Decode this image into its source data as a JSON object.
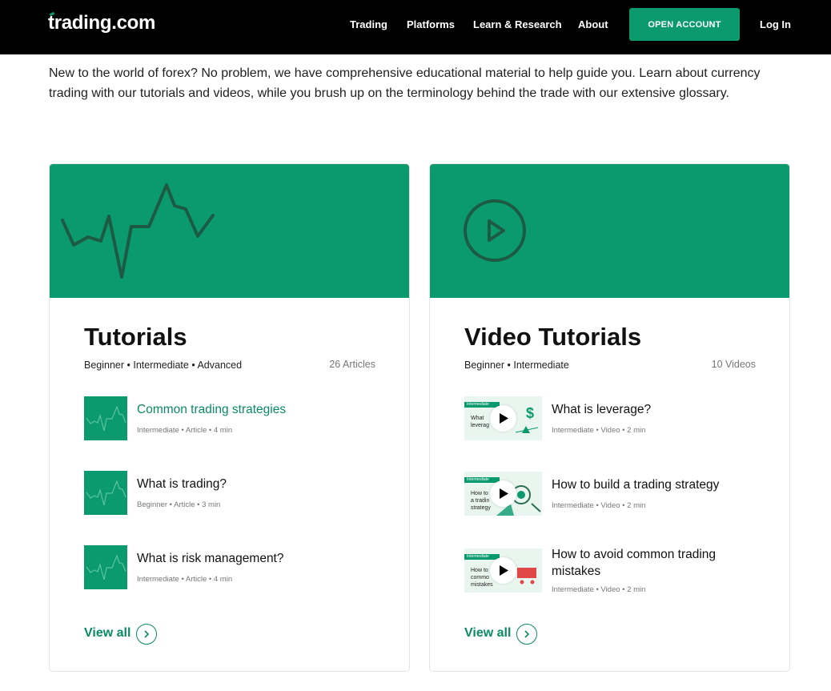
{
  "nav": {
    "logo": "trading.com",
    "links": [
      "Trading",
      "Platforms",
      "Learn & Research",
      "About"
    ],
    "open_account": "OPEN ACCOUNT",
    "login": "Log In"
  },
  "intro": "New to the world of forex? No problem, we have comprehensive educational material to help guide you. Learn about currency trading with our tutorials and videos, while you brush up on the terminology behind the trade with our extensive glossary.",
  "tutorials": {
    "hero_icon": "line-chart-icon",
    "title": "Tutorials",
    "levels": "Beginner • Intermediate • Advanced",
    "count": "26 Articles",
    "items": [
      {
        "title": "Common trading strategies",
        "meta": "Intermediate  •  Article  •  4 min"
      },
      {
        "title": "What is trading?",
        "meta": "Beginner  •  Article  •  3 min"
      },
      {
        "title": "What is risk management?",
        "meta": "Intermediate  •  Article  •  4 min"
      }
    ],
    "view_all": "View all"
  },
  "video_tutorials": {
    "hero_icon": "play-circle-icon",
    "title": "Video Tutorials",
    "levels": "Beginner • Intermediate",
    "count": "10 Videos",
    "items": [
      {
        "title": "What is leverage?",
        "meta": "Intermediate  •  Video  •  2 min",
        "thumb_tag": "Intermediate",
        "thumb_text": "What\nleverag"
      },
      {
        "title": "How to build a trading strategy",
        "meta": "Intermediate  •  Video  •  2 min",
        "thumb_tag": "Intermediate",
        "thumb_text": "How to\na tradin\nstrategy"
      },
      {
        "title": "How to avoid common trading mistakes",
        "meta": "Intermediate  •  Video  •  2 min",
        "thumb_tag": "Intermediate",
        "thumb_text": "How to\ncommon\nmistakes"
      }
    ],
    "view_all": "View all"
  },
  "colors": {
    "brand_green": "#0a9a6e",
    "nav_bg": "#000000",
    "link_green": "#0a8a63"
  }
}
